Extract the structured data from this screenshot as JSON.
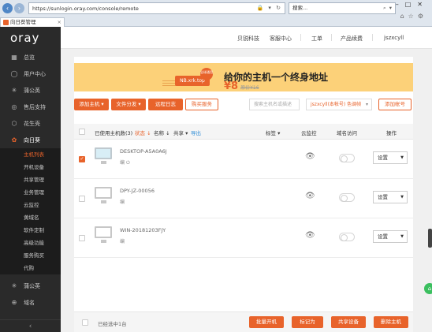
{
  "browser": {
    "url": "https://sunlogin.oray.com/console/remote",
    "search_placeholder": "搜索...",
    "tab_title": "向日葵管理"
  },
  "sidebar": {
    "logo": "oray",
    "items": [
      {
        "label": "总览",
        "icon": "grid-icon"
      },
      {
        "label": "用户中心",
        "icon": "user-icon"
      },
      {
        "label": "蒲公英",
        "icon": "dandelion-icon"
      },
      {
        "label": "售后支持",
        "icon": "support-icon"
      },
      {
        "label": "花生壳",
        "icon": "peanut-icon"
      },
      {
        "label": "向日葵",
        "icon": "sunflower-icon"
      }
    ],
    "sub_items": [
      "主机列表",
      "开机设备",
      "共享管理",
      "业务管理",
      "云监控",
      "黄域名",
      "软件定制",
      "高级功能",
      "服务购买",
      "代购"
    ],
    "bottom_items": [
      {
        "label": "蒲公英",
        "icon": "dandelion-icon"
      },
      {
        "label": "域名",
        "icon": "globe-icon"
      }
    ]
  },
  "topbar": {
    "nav": [
      "贝锐科技",
      "客服中心",
      "工单",
      "产品续费",
      "jszxcyll"
    ]
  },
  "banner": {
    "badge": "NB.xrk.top",
    "circle_text": "全球通用",
    "title": "给你的主机一个终身地址",
    "price": "¥8",
    "old_price": "原价¥16"
  },
  "toolbar": {
    "add_host": "添加主机",
    "file_share": "文件分发",
    "remote_log": "远程日志",
    "buy_service": "购买服务",
    "search_placeholder": "搜索主机名或描述",
    "account_select": "jszxcyll(本帐号) 色调帧",
    "add_account": "添加帐号"
  },
  "table": {
    "headers": {
      "used": "已使用主机数(3)",
      "status": "状态",
      "name": "名称",
      "share": "共享",
      "export": "导出",
      "tags": "标签",
      "cloud": "云监控",
      "domain": "域名访问",
      "ops": "操作"
    },
    "rows": [
      {
        "name": "DESKTOP-A5A0A6J",
        "sub": "编",
        "checked": true,
        "online": true,
        "settings": "设置"
      },
      {
        "name": "DPY-JZ-00056",
        "sub": "编",
        "checked": false,
        "online": false,
        "settings": "设置"
      },
      {
        "name": "WIN-20181203FJY",
        "sub": "编",
        "checked": false,
        "online": false,
        "settings": "设置"
      }
    ]
  },
  "footer": {
    "selected": "已经选中1台",
    "batch_power": "批量开机",
    "mark": "标记为",
    "share_device": "共享设备",
    "delete_host": "删除主机"
  }
}
